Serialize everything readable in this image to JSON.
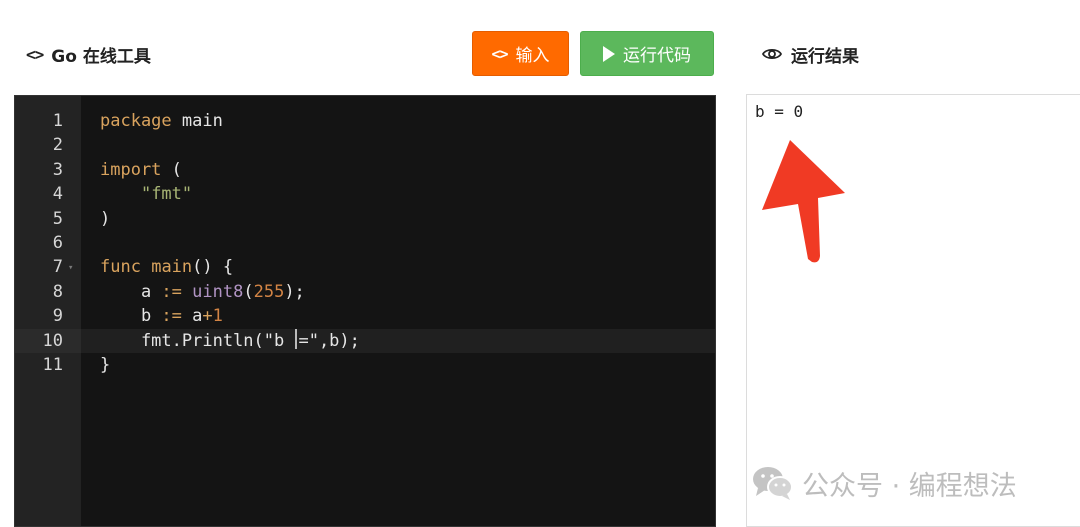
{
  "left_panel": {
    "icon": "code-brackets-icon",
    "icon_glyph": "<>",
    "title": "Go 在线工具"
  },
  "toolbar": {
    "input_button": {
      "icon": "code-brackets-icon",
      "icon_glyph": "<>",
      "label": "输入",
      "color": "#ff6a00"
    },
    "run_button": {
      "icon": "play-icon",
      "label": "运行代码",
      "color": "#5cb85c"
    }
  },
  "right_panel": {
    "icon": "eye-icon",
    "title": "运行结果"
  },
  "editor": {
    "background": "#141414",
    "active_line": 10,
    "lines": [
      {
        "number": "1",
        "tokens": [
          {
            "text": "package",
            "kind": "kw"
          },
          {
            "text": " main",
            "kind": "plain"
          }
        ]
      },
      {
        "number": "2",
        "tokens": []
      },
      {
        "number": "3",
        "tokens": [
          {
            "text": "import",
            "kind": "kw"
          },
          {
            "text": " (",
            "kind": "plain"
          }
        ]
      },
      {
        "number": "4",
        "tokens": [
          {
            "text": "    ",
            "kind": "plain"
          },
          {
            "text": "\"fmt\"",
            "kind": "str"
          }
        ]
      },
      {
        "number": "5",
        "tokens": [
          {
            "text": ")",
            "kind": "plain"
          }
        ]
      },
      {
        "number": "6",
        "tokens": []
      },
      {
        "number": "7",
        "fold": true,
        "tokens": [
          {
            "text": "func",
            "kind": "kw"
          },
          {
            "text": " ",
            "kind": "plain"
          },
          {
            "text": "main",
            "kind": "kw"
          },
          {
            "text": "() {",
            "kind": "plain"
          }
        ]
      },
      {
        "number": "8",
        "tokens": [
          {
            "text": "    a ",
            "kind": "plain"
          },
          {
            "text": ":=",
            "kind": "op"
          },
          {
            "text": " ",
            "kind": "plain"
          },
          {
            "text": "uint8",
            "kind": "type"
          },
          {
            "text": "(",
            "kind": "plain"
          },
          {
            "text": "255",
            "kind": "num"
          },
          {
            "text": ");",
            "kind": "plain"
          }
        ]
      },
      {
        "number": "9",
        "tokens": [
          {
            "text": "    b ",
            "kind": "plain"
          },
          {
            "text": ":=",
            "kind": "op"
          },
          {
            "text": " a",
            "kind": "plain"
          },
          {
            "text": "+",
            "kind": "op"
          },
          {
            "text": "1",
            "kind": "num"
          }
        ]
      },
      {
        "number": "10",
        "tokens": [
          {
            "text": "    fmt.Println(\"b ",
            "kind": "plain"
          },
          {
            "text": "|cursor|",
            "kind": "cursor"
          },
          {
            "text": "=\",b);",
            "kind": "plain"
          }
        ]
      },
      {
        "number": "11",
        "tokens": [
          {
            "text": "}",
            "kind": "plain"
          }
        ]
      }
    ]
  },
  "output": {
    "text": "b = 0",
    "annotation": "red-arrow-up"
  },
  "watermark": {
    "icon": "wechat-icon",
    "text": "公众号 · 编程想法"
  }
}
